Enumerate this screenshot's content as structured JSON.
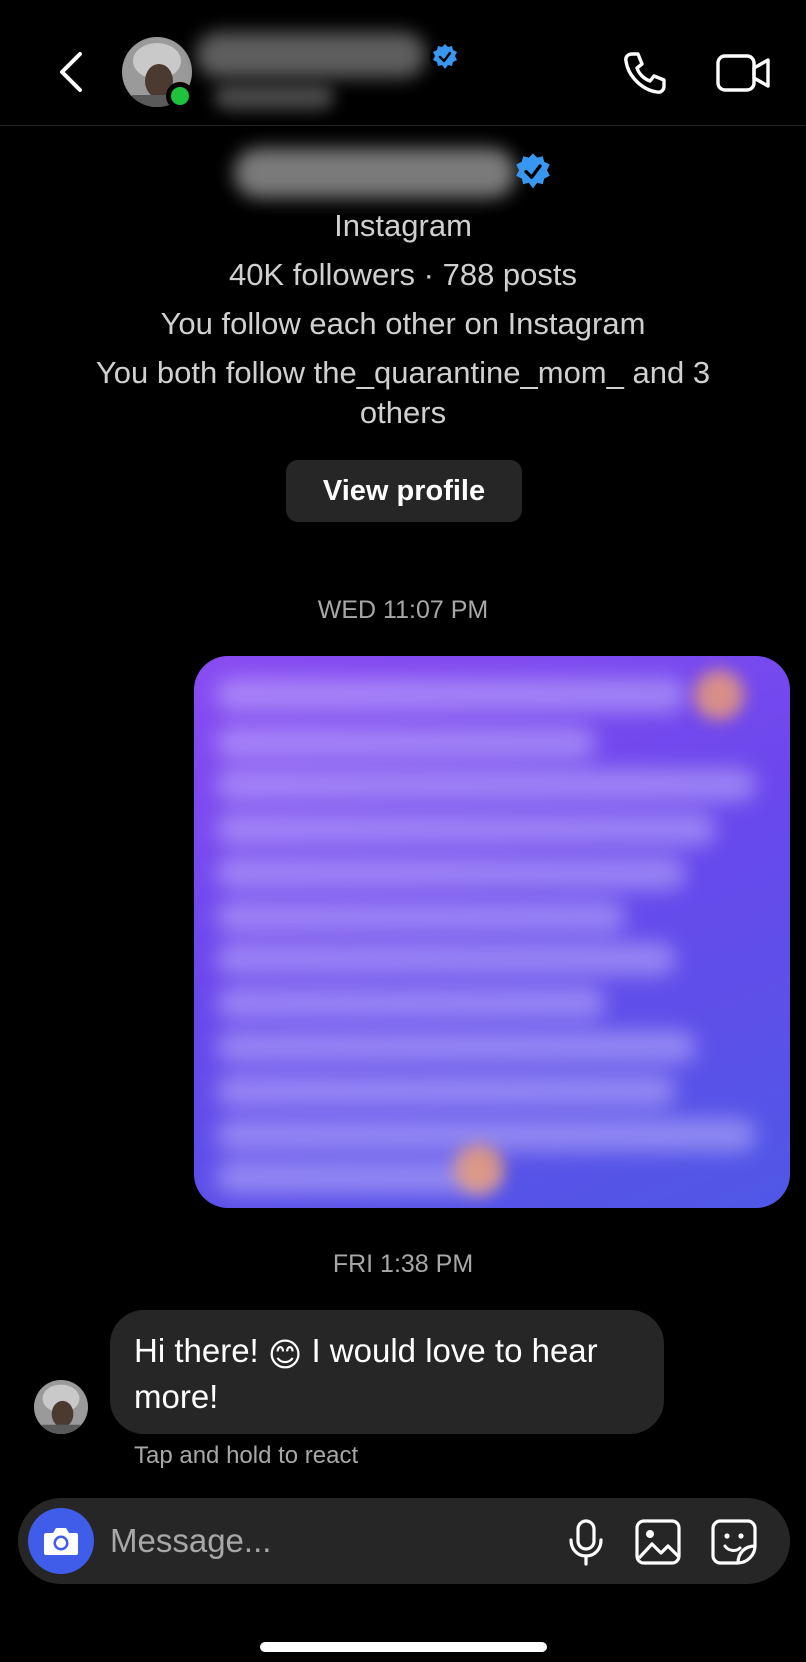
{
  "header": {
    "back_icon": "chevron-left-icon",
    "call_icon": "phone-icon",
    "video_icon": "video-camera-icon",
    "online": true,
    "accent_verified": "#3897f0",
    "online_color": "#1fc23b"
  },
  "profile": {
    "platform": "Instagram",
    "stats": "40K followers · 788 posts",
    "mutual_status": "You follow each other on Instagram",
    "mutual_line1": "You both follow the_quarantine_mom_ and 3",
    "mutual_line2": "others",
    "view_profile_label": "View profile"
  },
  "thread": {
    "timestamp_1": "WED 11:07 PM",
    "timestamp_2": "FRI 1:38 PM",
    "incoming_message_part1": "Hi there! ",
    "incoming_message_emoji": "😊",
    "incoming_message_part2": " I would love to hear more!",
    "react_hint": "Tap and hold to react"
  },
  "composer": {
    "placeholder": "Message...",
    "camera_icon": "camera-icon",
    "mic_icon": "microphone-icon",
    "gallery_icon": "gallery-icon",
    "sticker_icon": "sticker-icon",
    "camera_color": "#3f5de8"
  }
}
